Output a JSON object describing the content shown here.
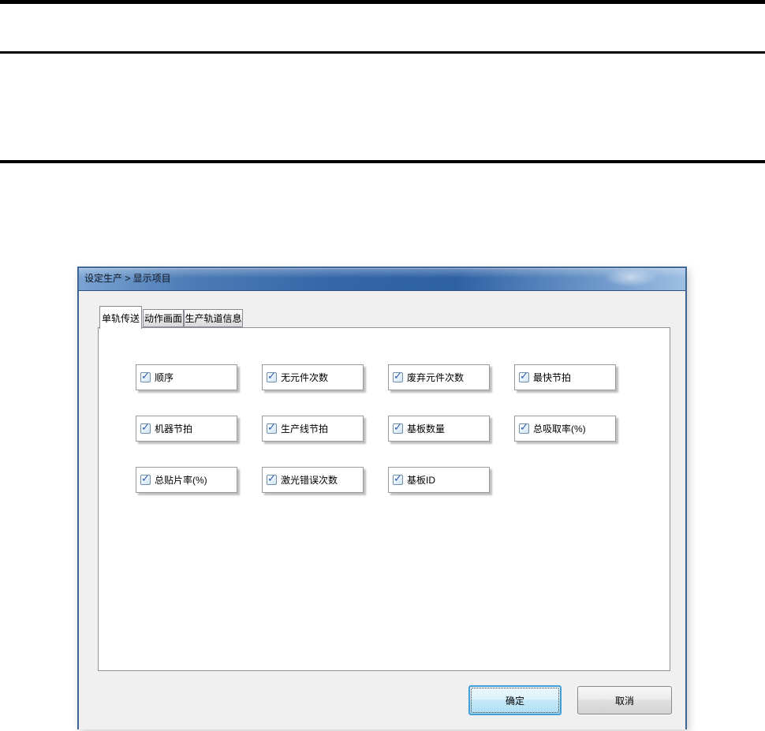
{
  "icons": {
    "check": "✓"
  },
  "dialog": {
    "title": "设定生产 > 显示项目",
    "tabs": [
      {
        "label": "单轨传送",
        "active": true
      },
      {
        "label": "动作画面",
        "active": false
      },
      {
        "label": "生产轨道信息",
        "active": false
      }
    ],
    "items": [
      {
        "label": "顺序",
        "checked": true
      },
      {
        "label": "无元件次数",
        "checked": true
      },
      {
        "label": "废弃元件次数",
        "checked": true
      },
      {
        "label": "最快节拍",
        "checked": true
      },
      {
        "label": "机器节拍",
        "checked": true
      },
      {
        "label": "生产线节拍",
        "checked": true
      },
      {
        "label": "基板数量",
        "checked": true
      },
      {
        "label": "总吸取率(%)",
        "checked": true
      },
      {
        "label": "总贴片率(%)",
        "checked": true
      },
      {
        "label": "激光错误次数",
        "checked": true
      },
      {
        "label": "基板ID",
        "checked": true
      }
    ],
    "buttons": {
      "ok": "确定",
      "cancel": "取消"
    },
    "colors": {
      "titlebar_blue": "#3466a9",
      "dialog_border": "#3f6496",
      "ok_border": "#41a0d5",
      "checkbox_check": "#2b5cad",
      "client_bg": "#f0f0f0"
    }
  }
}
